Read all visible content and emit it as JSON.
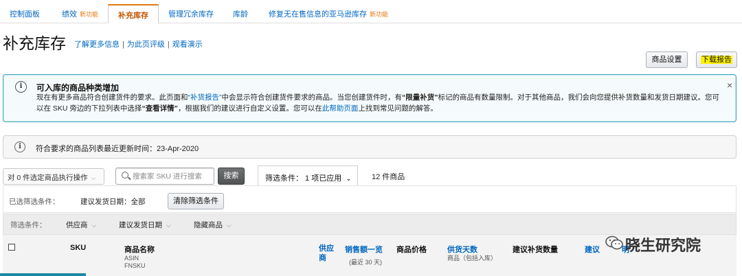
{
  "tabs": [
    {
      "label": "控制面板",
      "badge": ""
    },
    {
      "label": "绩效",
      "badge": "新功能"
    },
    {
      "label": "补充库存",
      "badge": "",
      "active": true
    },
    {
      "label": "管理冗余库存",
      "badge": ""
    },
    {
      "label": "库龄",
      "badge": ""
    },
    {
      "label": "修复无在售信息的亚马逊库存",
      "badge": "新功能"
    }
  ],
  "header": {
    "title": "补充库存",
    "links": [
      "了解更多信息",
      "为此页评级",
      "观看演示"
    ],
    "settings_button": "商品设置",
    "download_button": "下载报告"
  },
  "info_alert": {
    "title": "可入库的商品种类增加",
    "line1_a": "现在有更多商品符合创建货件的要求。此页面和",
    "line1_link": "“补货报告”",
    "line1_b": "中会显示符合创建货件要求的商品。当您创建货件时，有",
    "line1_bold": "“限量补货”",
    "line1_c": "标记的商品有数量限制。对于其他商品，我们会向您提供补货数量和发货日期建议。您可",
    "line2_a": "以在 SKU 旁边的下拉列表中选择",
    "line2_bold": "“查看详情”",
    "line2_b": "，根据我们的建议进行自定义设置。您可以在",
    "line2_link": "此帮助页面",
    "line2_c": "上找到常见问题的解答。",
    "close": "×"
  },
  "update_notice": {
    "text": "符合要求的商品列表最近更新时间：23-Apr-2020"
  },
  "toolbar": {
    "bulk_action": "对 0 件选定商品执行操作",
    "search_placeholder": "搜索家 SKU 进行搜索",
    "search_button": "搜索",
    "filter_tab": "筛选条件： 1 项已应用",
    "product_count": "12 件商品"
  },
  "applied_filters": {
    "label": "已选筛选条件：",
    "value": "建议发货日期：全部",
    "clear_button": "清除筛选条件"
  },
  "filters": {
    "label": "筛选条件：",
    "items": [
      "供应商",
      "建议发货日期",
      "隐藏商品"
    ]
  },
  "table": {
    "columns": {
      "sku": "SKU",
      "name": "商品名称",
      "name_sub1": "ASIN",
      "name_sub2": "FNSKU",
      "supplier_1": "供应",
      "supplier_2": "商",
      "sales": "销售额一览",
      "sales_sub": "(最近 30 天)",
      "price": "商品价格",
      "days": "供货天数",
      "days_sub": "商品（包括入库）",
      "qty": "建议补货数量",
      "date_partial": "建议",
      "last_partial": "明"
    }
  },
  "watermark": {
    "text": "晓生研究院"
  },
  "colors": {
    "link": "#0066c0",
    "active_tab": "#c45500",
    "tab_accent": "#e47911",
    "info_border": "#41a7c1",
    "highlight": "#fff200"
  }
}
